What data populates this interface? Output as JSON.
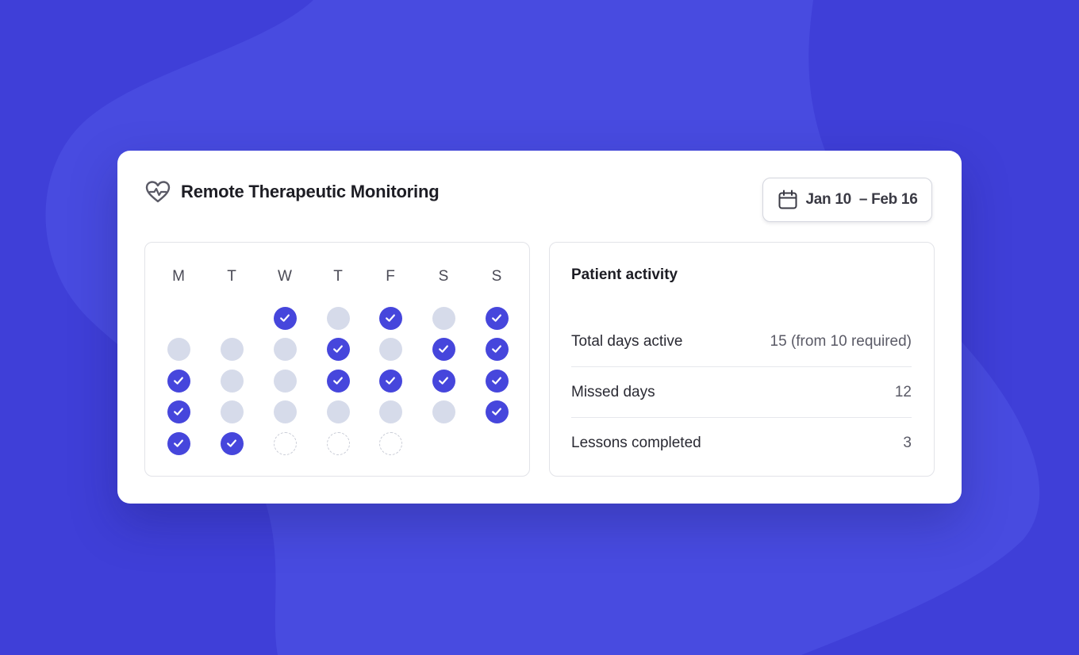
{
  "colors": {
    "background": "#3f3fd8",
    "accent": "#4646dc",
    "inactive_day": "#d6dbea",
    "card": "#ffffff"
  },
  "card": {
    "title": "Remote Therapeutic Monitoring",
    "title_icon": "heart-pulse-icon",
    "date_range": {
      "icon": "calendar-icon",
      "label": "Jan 10  – Feb 16"
    }
  },
  "calendar": {
    "weekdays": [
      "M",
      "T",
      "W",
      "T",
      "F",
      "S",
      "S"
    ],
    "rows": [
      [
        "empty",
        "empty",
        "checked",
        "inactive",
        "checked",
        "inactive",
        "checked"
      ],
      [
        "inactive",
        "inactive",
        "inactive",
        "checked",
        "inactive",
        "checked",
        "checked"
      ],
      [
        "checked",
        "inactive",
        "inactive",
        "checked",
        "checked",
        "checked",
        "checked"
      ],
      [
        "checked",
        "inactive",
        "inactive",
        "inactive",
        "inactive",
        "inactive",
        "checked"
      ],
      [
        "checked",
        "checked",
        "future",
        "future",
        "future",
        "empty",
        "empty"
      ]
    ]
  },
  "activity": {
    "title": "Patient activity",
    "rows": [
      {
        "label": "Total days active",
        "value": "15 (from 10 required)"
      },
      {
        "label": "Missed days",
        "value": "12"
      },
      {
        "label": "Lessons completed",
        "value": "3"
      }
    ]
  }
}
